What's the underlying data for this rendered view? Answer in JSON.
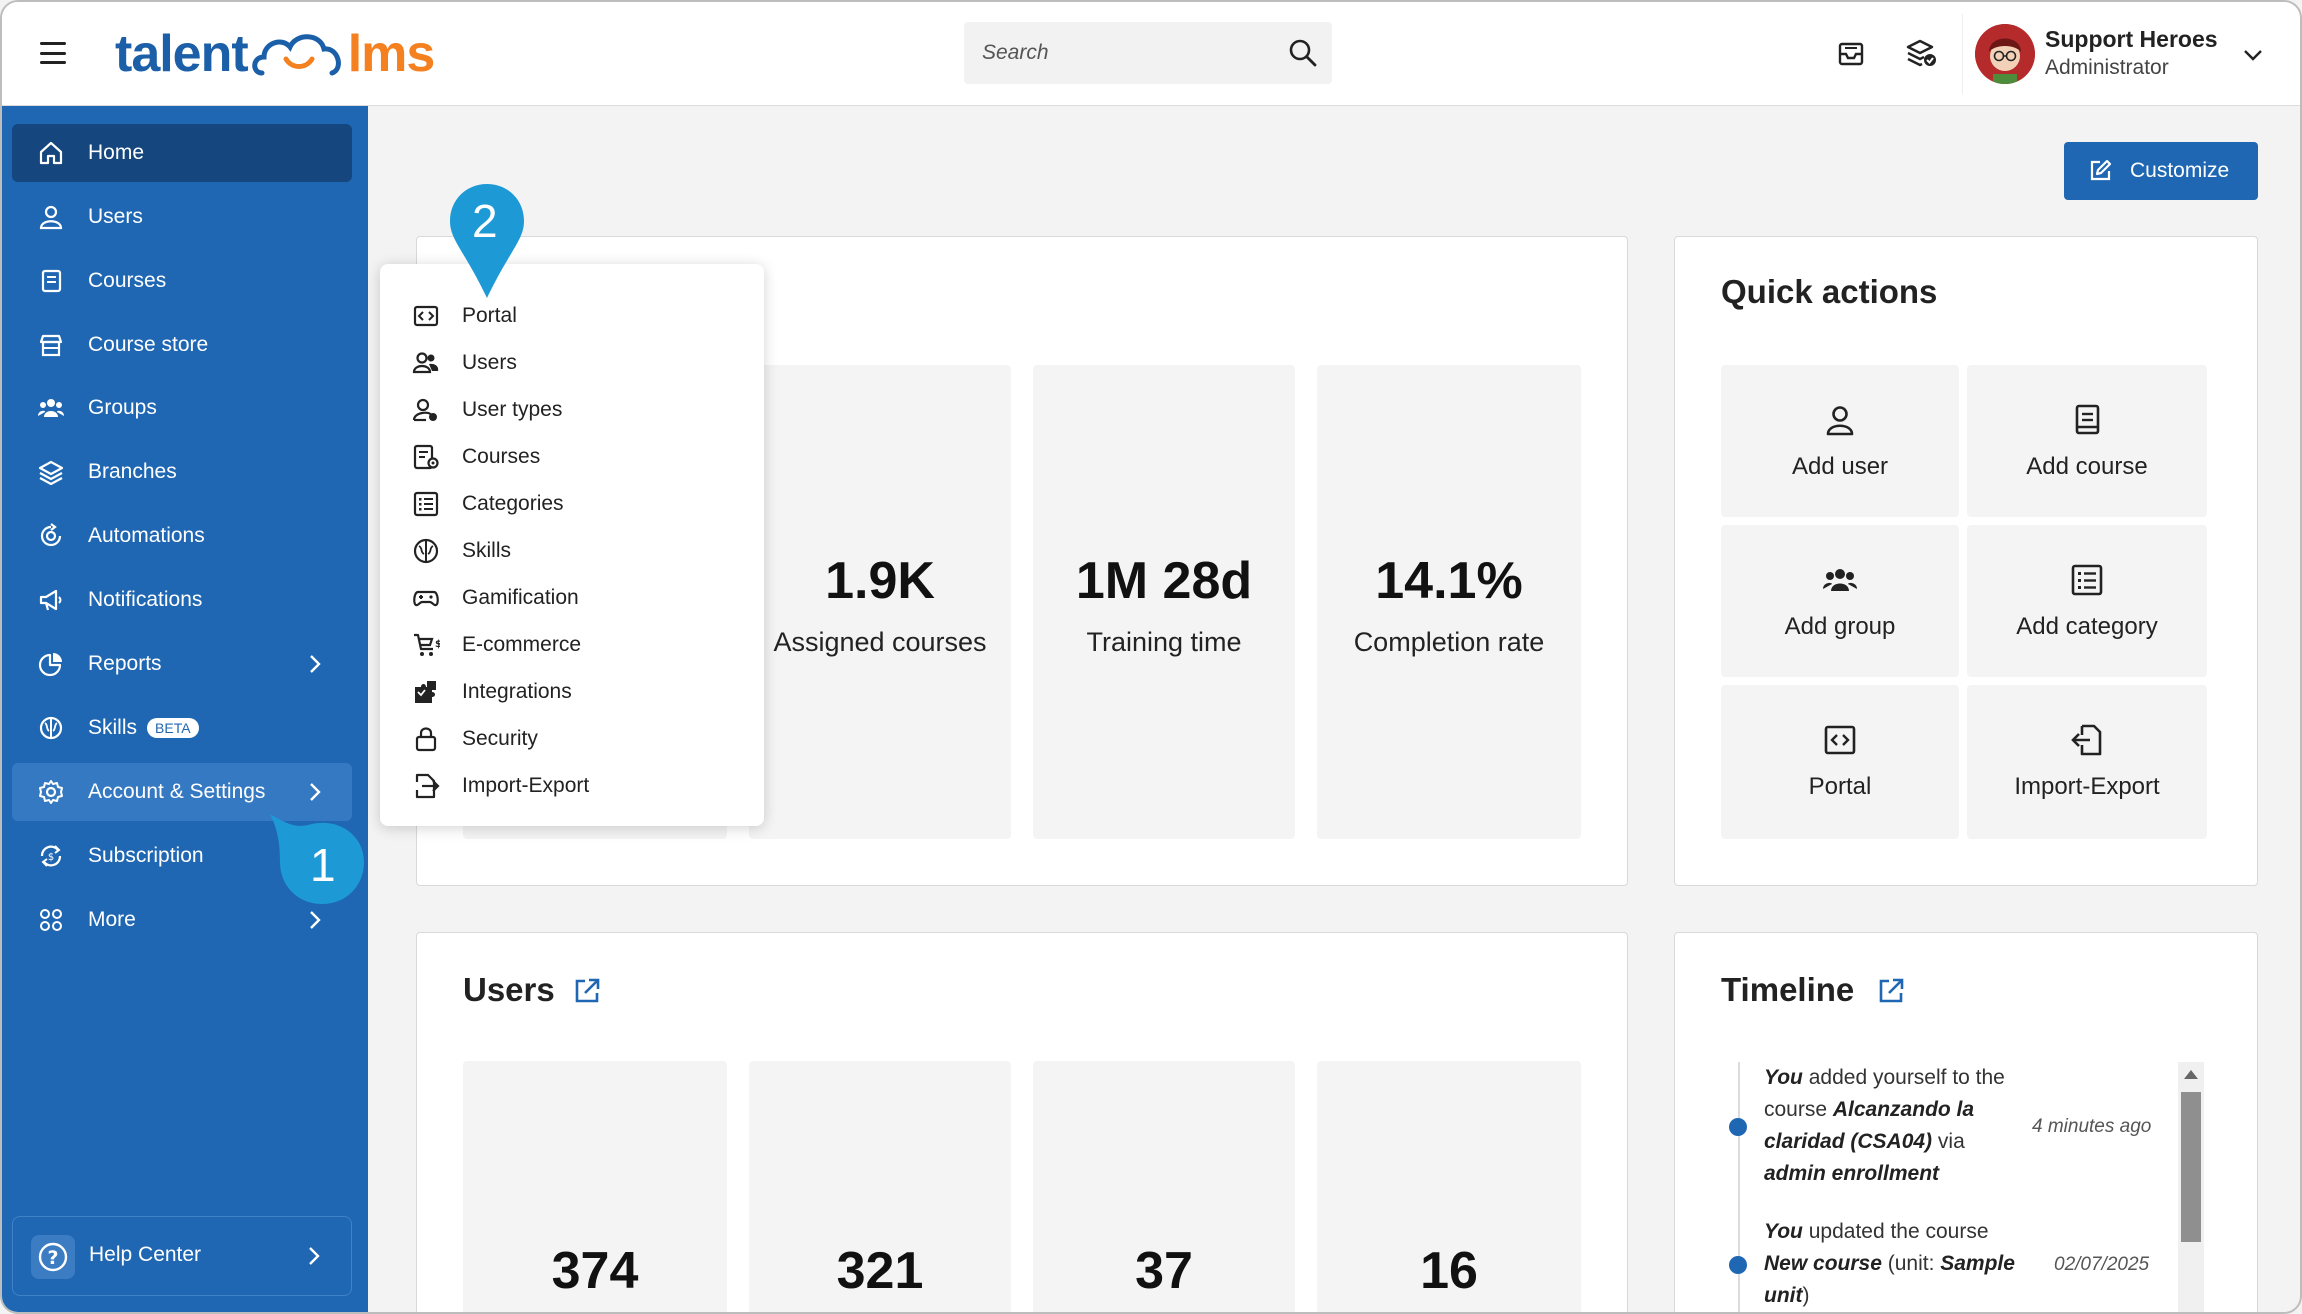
{
  "app": {
    "logo_left": "talent",
    "logo_right": "lms"
  },
  "search": {
    "placeholder": "Search"
  },
  "profile": {
    "name": "Support Heroes",
    "role": "Administrator"
  },
  "sidebar": {
    "items": [
      {
        "label": "Home",
        "icon": "home-icon"
      },
      {
        "label": "Users",
        "icon": "user-icon"
      },
      {
        "label": "Courses",
        "icon": "book-icon"
      },
      {
        "label": "Course store",
        "icon": "store-icon"
      },
      {
        "label": "Groups",
        "icon": "group-icon"
      },
      {
        "label": "Branches",
        "icon": "layers-icon"
      },
      {
        "label": "Automations",
        "icon": "automation-icon"
      },
      {
        "label": "Notifications",
        "icon": "megaphone-icon"
      },
      {
        "label": "Reports",
        "icon": "pie-chart-icon"
      },
      {
        "label": "Skills",
        "icon": "brain-icon",
        "badge": "BETA"
      },
      {
        "label": "Account & Settings",
        "icon": "gear-icon"
      },
      {
        "label": "Subscription",
        "icon": "subscription-icon"
      },
      {
        "label": "More",
        "icon": "grid-icon"
      }
    ],
    "help": "Help Center"
  },
  "toolbar": {
    "customize_label": "Customize"
  },
  "overview": {
    "stats": [
      {
        "value": "1.9K",
        "label": "Assigned courses"
      },
      {
        "value": "1M 28d",
        "label": "Training time"
      },
      {
        "value": "14.1%",
        "label": "Completion rate"
      }
    ]
  },
  "quick_actions": {
    "title": "Quick actions",
    "items": [
      {
        "label": "Add user",
        "icon": "user-icon"
      },
      {
        "label": "Add course",
        "icon": "book-icon"
      },
      {
        "label": "Add group",
        "icon": "group-icon"
      },
      {
        "label": "Add category",
        "icon": "list-icon"
      },
      {
        "label": "Portal",
        "icon": "code-icon"
      },
      {
        "label": "Import-Export",
        "icon": "import-export-icon"
      }
    ]
  },
  "users_card": {
    "title": "Users",
    "stats": [
      "374",
      "321",
      "37",
      "16"
    ]
  },
  "timeline": {
    "title": "Timeline",
    "entries": [
      {
        "actor": "You",
        "text1": " added yourself to the course ",
        "course": "Alcanzando la claridad (CSA04)",
        "text2": " via ",
        "method": "admin enrollment",
        "time": "4 minutes ago"
      },
      {
        "actor": "You",
        "text1": " updated the course ",
        "course": "New course",
        "text2": " (unit: ",
        "unit": "Sample unit",
        "text3": ")",
        "time": "02/07/2025"
      }
    ]
  },
  "menu": {
    "items": [
      {
        "label": "Portal",
        "icon": "code-icon"
      },
      {
        "label": "Users",
        "icon": "users-icon"
      },
      {
        "label": "User types",
        "icon": "user-types-icon"
      },
      {
        "label": "Courses",
        "icon": "course-settings-icon"
      },
      {
        "label": "Categories",
        "icon": "list-icon"
      },
      {
        "label": "Skills",
        "icon": "brain-icon"
      },
      {
        "label": "Gamification",
        "icon": "gamepad-icon"
      },
      {
        "label": "E-commerce",
        "icon": "cart-icon"
      },
      {
        "label": "Integrations",
        "icon": "puzzle-icon"
      },
      {
        "label": "Security",
        "icon": "lock-icon"
      },
      {
        "label": "Import-Export",
        "icon": "import-export-icon"
      }
    ]
  },
  "callouts": {
    "one": "1",
    "two": "2"
  },
  "colors": {
    "primary": "#1f67b3",
    "primary_dark": "#15467e",
    "accent": "#f4801f",
    "callout": "#1d9ad6"
  }
}
